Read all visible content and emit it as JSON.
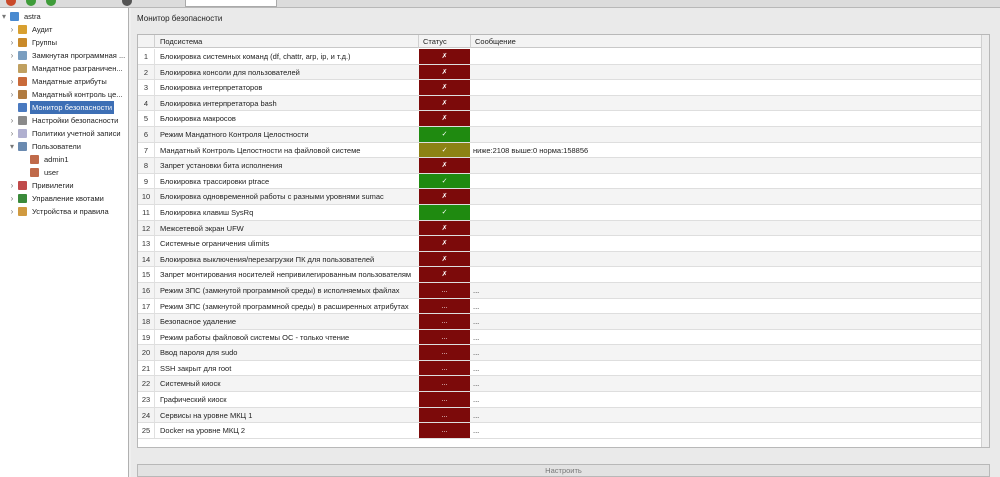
{
  "toolbar": {
    "icons": [
      "record-icon",
      "refresh-icon",
      "back-icon",
      "stop-icon"
    ]
  },
  "tree": {
    "root": "astra",
    "items": [
      {
        "label": "Аудит",
        "icon": "audit-icon",
        "expandable": true
      },
      {
        "label": "Группы",
        "icon": "groups-icon",
        "expandable": true
      },
      {
        "label": "Замкнутая программная ...",
        "icon": "closed-env-icon",
        "expandable": true
      },
      {
        "label": "Мандатное разграничен...",
        "icon": "mandatory-access-icon",
        "expandable": false
      },
      {
        "label": "Мандатные атрибуты",
        "icon": "mandatory-attr-icon",
        "expandable": true
      },
      {
        "label": "Мандатный контроль це...",
        "icon": "integrity-control-icon",
        "expandable": true
      },
      {
        "label": "Монитор безопасности",
        "icon": "security-monitor-icon",
        "expandable": false,
        "selected": true
      },
      {
        "label": "Настройки безопасности",
        "icon": "security-settings-icon",
        "expandable": true
      },
      {
        "label": "Политики учетной записи",
        "icon": "account-policy-icon",
        "expandable": true
      },
      {
        "label": "Пользователи",
        "icon": "users-icon",
        "expandable": true,
        "expanded": true
      },
      {
        "label": "admin1",
        "icon": "user-icon",
        "child": true
      },
      {
        "label": "user",
        "icon": "user-icon",
        "child": true
      },
      {
        "label": "Привилегии",
        "icon": "privileges-icon",
        "expandable": true
      },
      {
        "label": "Управление квотами",
        "icon": "quotas-icon",
        "expandable": true
      },
      {
        "label": "Устройства и правила",
        "icon": "devices-icon",
        "expandable": true
      }
    ]
  },
  "main": {
    "title": "Монитор безопасности",
    "columns": {
      "subsystem": "Подсистема",
      "status": "Статус",
      "message": "Сообщение"
    },
    "configure_label": "Настроить",
    "rows": [
      {
        "n": "1",
        "name": "Блокировка системных команд (df, chattr, arp, ip, и т.д.)",
        "status": "✗",
        "state": "red",
        "msg": ""
      },
      {
        "n": "2",
        "name": "Блокировка консоли для пользователей",
        "status": "✗",
        "state": "red",
        "msg": ""
      },
      {
        "n": "3",
        "name": "Блокировка интерпретаторов",
        "status": "✗",
        "state": "red",
        "msg": ""
      },
      {
        "n": "4",
        "name": "Блокировка интерпретатора bash",
        "status": "✗",
        "state": "red",
        "msg": ""
      },
      {
        "n": "5",
        "name": "Блокировка макросов",
        "status": "✗",
        "state": "red",
        "msg": ""
      },
      {
        "n": "6",
        "name": "Режим Мандатного Контроля Целостности",
        "status": "✓",
        "state": "green",
        "msg": ""
      },
      {
        "n": "7",
        "name": "Мандатный Контроль Целостности на файловой системе",
        "status": "✓",
        "state": "olive",
        "msg": "ниже:2108 выше:0 норма:158856"
      },
      {
        "n": "8",
        "name": "Запрет установки бита исполнения",
        "status": "✗",
        "state": "red",
        "msg": ""
      },
      {
        "n": "9",
        "name": "Блокировка трассировки ptrace",
        "status": "✓",
        "state": "green",
        "msg": ""
      },
      {
        "n": "10",
        "name": "Блокировка одновременной работы с разными уровнями sumac",
        "status": "✗",
        "state": "red",
        "msg": ""
      },
      {
        "n": "11",
        "name": "Блокировка клавиш SysRq",
        "status": "✓",
        "state": "green",
        "msg": ""
      },
      {
        "n": "12",
        "name": "Межсетевой экран UFW",
        "status": "✗",
        "state": "red",
        "msg": ""
      },
      {
        "n": "13",
        "name": "Системные ограничения ulimits",
        "status": "✗",
        "state": "red",
        "msg": ""
      },
      {
        "n": "14",
        "name": "Блокировка выключения/перезагрузки ПК для пользователей",
        "status": "✗",
        "state": "red",
        "msg": ""
      },
      {
        "n": "15",
        "name": "Запрет монтирования носителей непривилегированным пользователям",
        "status": "✗",
        "state": "red",
        "msg": ""
      },
      {
        "n": "16",
        "name": "Режим ЗПС (замкнутой программной среды) в исполняемых файлах",
        "status": "...",
        "state": "red",
        "msg": "..."
      },
      {
        "n": "17",
        "name": "Режим ЗПС (замкнутой программной среды) в расширенных атрибутах",
        "status": "...",
        "state": "red",
        "msg": "..."
      },
      {
        "n": "18",
        "name": "Безопасное удаление",
        "status": "...",
        "state": "red",
        "msg": "..."
      },
      {
        "n": "19",
        "name": "Режим работы файловой системы ОС - только чтение",
        "status": "...",
        "state": "red",
        "msg": "..."
      },
      {
        "n": "20",
        "name": "Ввод пароля для sudo",
        "status": "...",
        "state": "red",
        "msg": "..."
      },
      {
        "n": "21",
        "name": "SSH закрыт для root",
        "status": "...",
        "state": "red",
        "msg": "..."
      },
      {
        "n": "22",
        "name": "Системный киоск",
        "status": "...",
        "state": "red",
        "msg": "..."
      },
      {
        "n": "23",
        "name": "Графический киоск",
        "status": "...",
        "state": "red",
        "msg": "..."
      },
      {
        "n": "24",
        "name": "Сервисы на уровне МКЦ 1",
        "status": "...",
        "state": "red",
        "msg": "..."
      },
      {
        "n": "25",
        "name": "Docker на уровне МКЦ 2",
        "status": "...",
        "state": "red",
        "msg": "..."
      }
    ]
  },
  "colors": {
    "status_red": "#7c0a0a",
    "status_green": "#1f8a10",
    "status_olive": "#8c8214",
    "selection": "#3d6fb5"
  }
}
